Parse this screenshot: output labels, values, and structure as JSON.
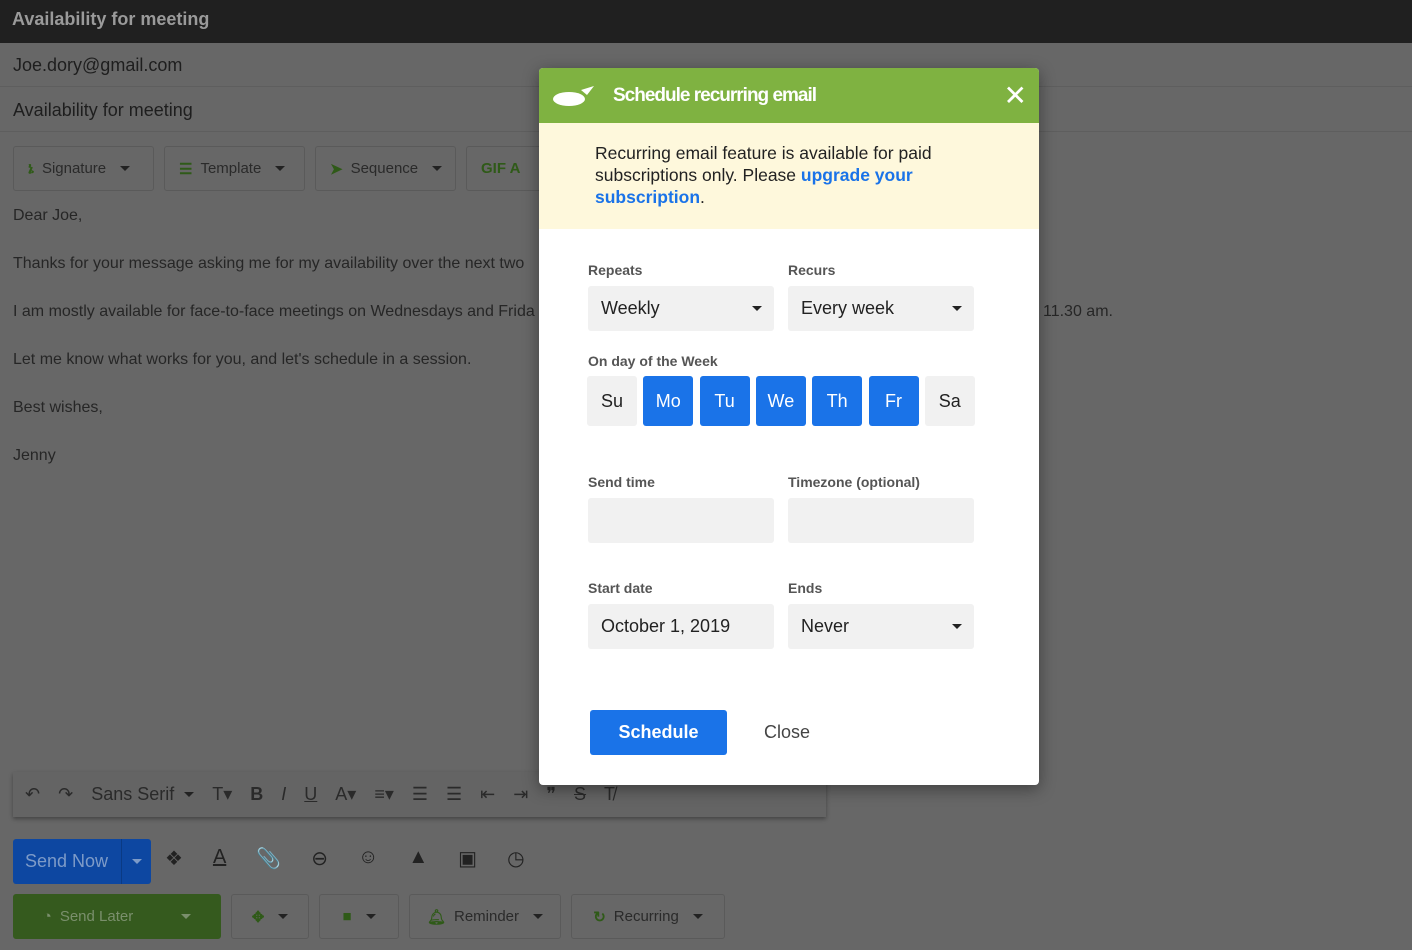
{
  "window": {
    "title": "Availability for meeting"
  },
  "compose": {
    "to": "Joe.dory@gmail.com",
    "subject": "Availability for meeting",
    "toolbar": [
      "Signature",
      "Template",
      "Sequence",
      "GIF A"
    ],
    "body": [
      "Dear Joe,",
      "Thanks for your message asking me for my availability over the next two",
      "I am mostly available for face-to-face meetings on Wednesdays and Frida",
      "11.30 am.",
      "Let me know what works for you, and let's schedule in a session.",
      "Best wishes,",
      "Jenny"
    ],
    "font": "Sans Serif",
    "send_now": "Send Now",
    "send_later": "Send Later",
    "reminder": "Reminder",
    "recurring": "Recurring"
  },
  "modal": {
    "title": "Schedule recurring email",
    "notice_text": "Recurring email feature is available for paid subscriptions only. Please ",
    "notice_link": "upgrade your subscription",
    "notice_end": ".",
    "repeats_label": "Repeats",
    "repeats": "Weekly",
    "recurs_label": "Recurs",
    "recurs": "Every week",
    "days_label": "On day of the Week",
    "days": [
      {
        "label": "Su",
        "selected": false
      },
      {
        "label": "Mo",
        "selected": true
      },
      {
        "label": "Tu",
        "selected": true
      },
      {
        "label": "We",
        "selected": true
      },
      {
        "label": "Th",
        "selected": true
      },
      {
        "label": "Fr",
        "selected": true
      },
      {
        "label": "Sa",
        "selected": false
      }
    ],
    "send_time_label": "Send time",
    "send_time": "",
    "timezone_label": "Timezone (optional)",
    "timezone": "",
    "start_date_label": "Start date",
    "start_date": "October 1, 2019",
    "ends_label": "Ends",
    "ends": "Never",
    "schedule": "Schedule",
    "close": "Close"
  },
  "colors": {
    "accent": "#1a73e8",
    "header": "#7fb241",
    "notice": "#fef8dc"
  }
}
